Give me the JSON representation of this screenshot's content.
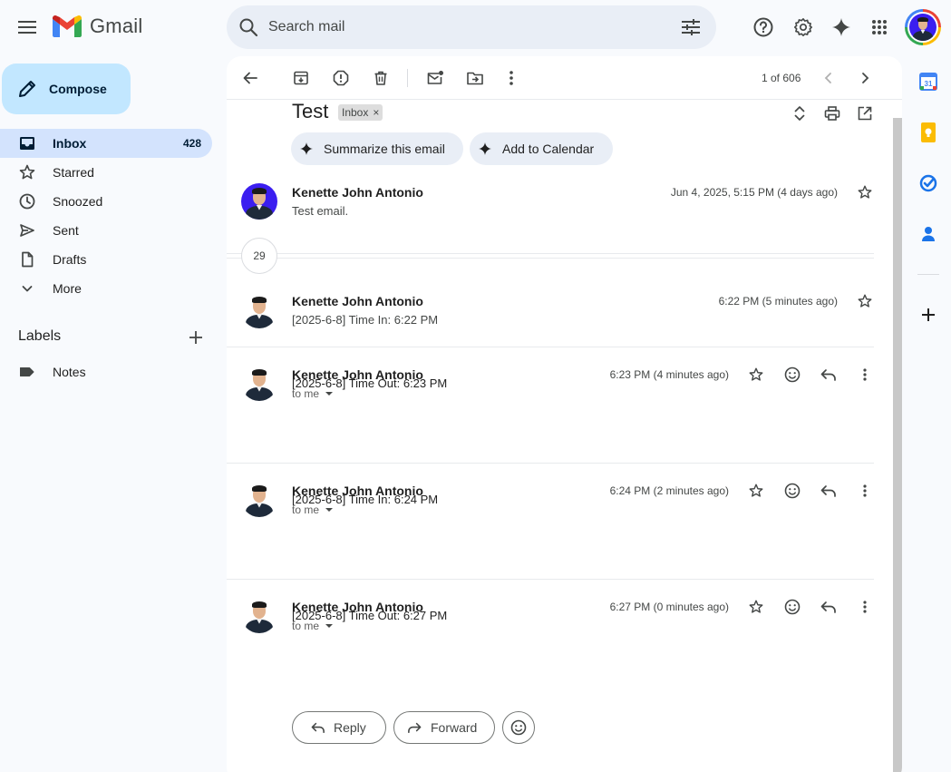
{
  "app": {
    "logo_text": "Gmail"
  },
  "search": {
    "placeholder": "Search mail"
  },
  "compose": {
    "label": "Compose"
  },
  "nav": [
    {
      "label": "Inbox",
      "count": "428"
    },
    {
      "label": "Starred"
    },
    {
      "label": "Snoozed"
    },
    {
      "label": "Sent"
    },
    {
      "label": "Drafts"
    },
    {
      "label": "More"
    }
  ],
  "labels": {
    "heading": "Labels",
    "items": [
      {
        "label": "Notes"
      }
    ]
  },
  "toolbar": {
    "pager": "1 of 606"
  },
  "thread": {
    "subject": "Test",
    "label_chip": "Inbox",
    "chip_close": "×",
    "ai_actions": [
      {
        "label": "Summarize this email"
      },
      {
        "label": "Add to Calendar"
      }
    ],
    "collapsed_count": "29"
  },
  "messages": [
    {
      "sender": "Kenette John Antonio",
      "snippet": "Test email.",
      "time": "Jun 4, 2025, 5:15 PM (4 days ago)"
    },
    {
      "sender": "Kenette John Antonio",
      "snippet": "[2025-6-8] Time In: 6:22 PM",
      "time": "6:22 PM (5 minutes ago)"
    },
    {
      "sender": "Kenette John Antonio",
      "to": "to me",
      "body": "[2025-6-8] Time Out: 6:23 PM",
      "time": "6:23 PM (4 minutes ago)"
    },
    {
      "sender": "Kenette John Antonio",
      "to": "to me",
      "body": "[2025-6-8] Time In: 6:24 PM",
      "time": "6:24 PM (2 minutes ago)"
    },
    {
      "sender": "Kenette John Antonio",
      "to": "to me",
      "body": "[2025-6-8] Time Out: 6:27 PM",
      "time": "6:27 PM (0 minutes ago)"
    }
  ],
  "actions": {
    "reply": "Reply",
    "forward": "Forward"
  },
  "colors": {
    "compose_bg": "#c2e7ff",
    "active_nav_bg": "#d3e3fd",
    "search_bg": "#e9eef6",
    "page_bg": "#f8fafd"
  },
  "icons": [
    "menu-icon",
    "gmail-logo-icon",
    "search-icon",
    "filter-icon",
    "help-icon",
    "gear-icon",
    "sparkle-icon",
    "apps-grid-icon",
    "pencil-icon",
    "inbox-icon",
    "star-icon",
    "clock-icon",
    "send-icon",
    "file-icon",
    "chevron-down-icon",
    "plus-icon",
    "label-icon",
    "arrow-left-icon",
    "archive-icon",
    "report-icon",
    "trash-icon",
    "mark-unread-icon",
    "move-icon",
    "more-vert-icon",
    "chevron-left-icon",
    "chevron-right-icon",
    "expand-icon",
    "print-icon",
    "open-external-icon",
    "emoji-icon",
    "reply-icon",
    "forward-icon",
    "calendar-icon",
    "keep-icon",
    "tasks-icon",
    "contacts-icon"
  ]
}
